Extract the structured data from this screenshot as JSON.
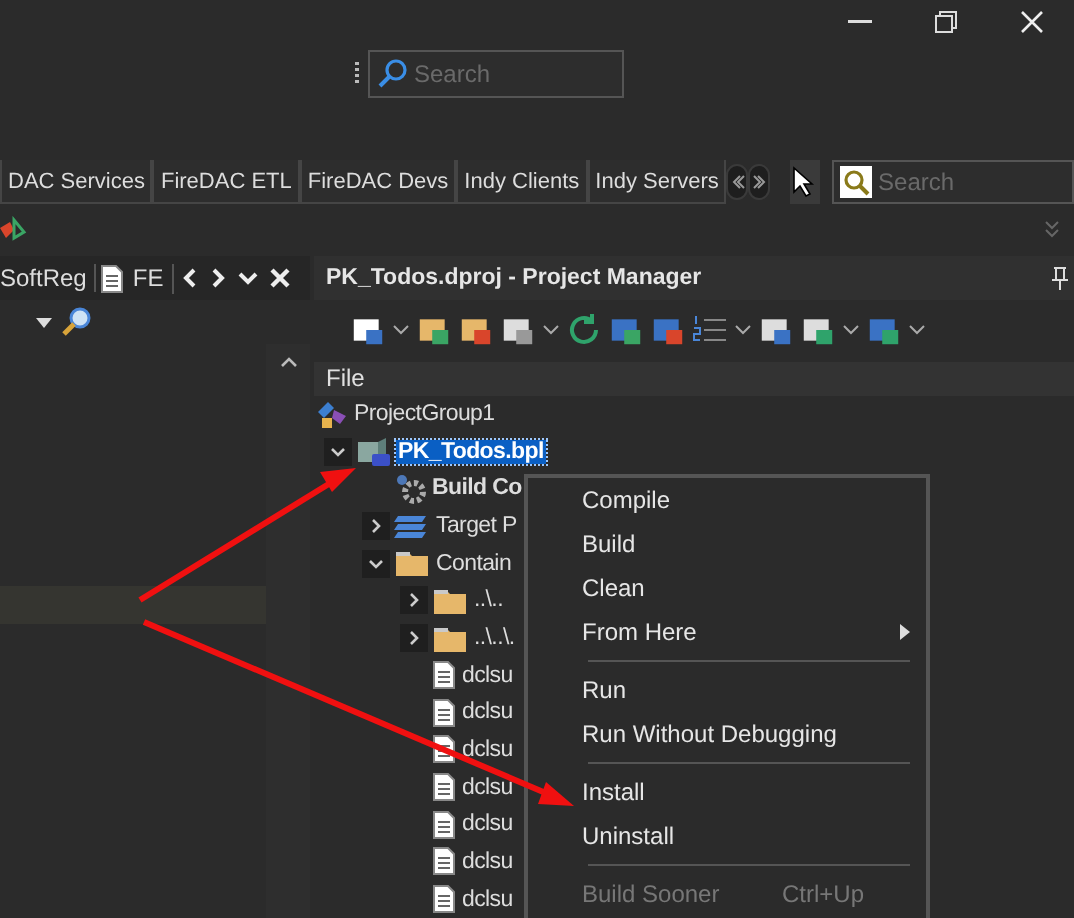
{
  "search": {
    "placeholder": "Search"
  },
  "palette": {
    "tabs": [
      {
        "label": "DAC Services"
      },
      {
        "label": "FireDAC ETL"
      },
      {
        "label": "FireDAC Devs"
      },
      {
        "label": "Indy Clients"
      },
      {
        "label": "Indy Servers"
      }
    ],
    "search_placeholder": "Search"
  },
  "editor_tabs": [
    {
      "label": "SoftReg",
      "kind": "plain"
    },
    {
      "label": "FE",
      "kind": "file"
    }
  ],
  "project_manager": {
    "title": "PK_Todos.dproj - Project Manager",
    "header": "File",
    "tree": [
      {
        "label": "ProjectGroup1",
        "kind": "group",
        "selected": false,
        "children": [
          {
            "label": "PK_Todos.bpl",
            "kind": "package",
            "expanded": true,
            "selected": true,
            "children": [
              {
                "label": "Build Co",
                "kind": "config",
                "selected": false
              },
              {
                "label": "Target P",
                "kind": "platforms",
                "expanded": false,
                "selected": false
              },
              {
                "label": "Contain",
                "kind": "folder",
                "expanded": true,
                "selected": false,
                "children": [
                  {
                    "label": "..\\..",
                    "kind": "folder",
                    "expanded": false,
                    "selected": false
                  },
                  {
                    "label": "..\\..\\.",
                    "kind": "folder",
                    "expanded": false,
                    "selected": false
                  },
                  {
                    "label": "dclsu",
                    "kind": "file",
                    "selected": false
                  },
                  {
                    "label": "dclsu",
                    "kind": "file",
                    "selected": false
                  },
                  {
                    "label": "dclsu",
                    "kind": "file",
                    "selected": false
                  },
                  {
                    "label": "dclsu",
                    "kind": "file",
                    "selected": false
                  },
                  {
                    "label": "dclsu",
                    "kind": "file",
                    "selected": false
                  },
                  {
                    "label": "dclsu",
                    "kind": "file",
                    "selected": false
                  },
                  {
                    "label": "dclsu",
                    "kind": "file",
                    "selected": false
                  }
                ]
              }
            ]
          }
        ]
      }
    ]
  },
  "context_menu": [
    {
      "kind": "item",
      "label": "Compile",
      "disabled": false
    },
    {
      "kind": "item",
      "label": "Build",
      "disabled": false
    },
    {
      "kind": "item",
      "label": "Clean",
      "disabled": false
    },
    {
      "kind": "submenu",
      "label": "From Here",
      "disabled": false
    },
    {
      "kind": "separator"
    },
    {
      "kind": "item",
      "label": "Run",
      "disabled": false
    },
    {
      "kind": "item",
      "label": "Run Without Debugging",
      "disabled": false
    },
    {
      "kind": "separator"
    },
    {
      "kind": "item",
      "label": "Install",
      "disabled": false
    },
    {
      "kind": "item",
      "label": "Uninstall",
      "disabled": false
    },
    {
      "kind": "separator"
    },
    {
      "kind": "item",
      "label": "Build Sooner",
      "shortcut": "Ctrl+Up",
      "disabled": true
    }
  ]
}
